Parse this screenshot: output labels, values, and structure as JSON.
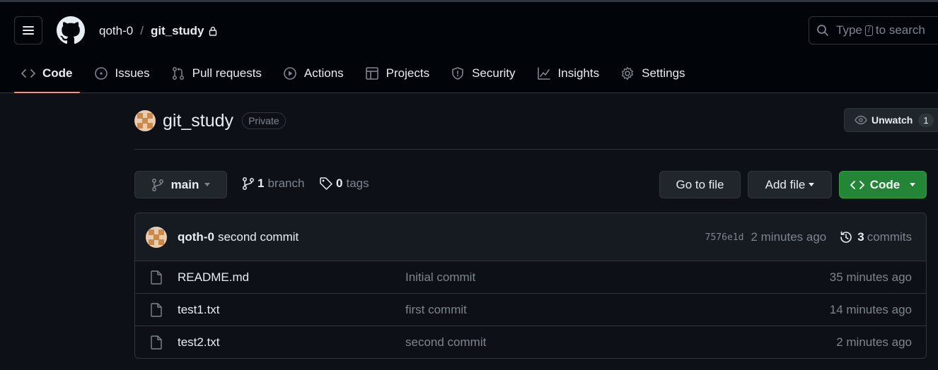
{
  "header": {
    "owner": "qoth-0",
    "separator": "/",
    "repo": "git_study",
    "search": {
      "prefix": "Type",
      "key": "/",
      "suffix": "to search"
    }
  },
  "tabs": [
    {
      "label": "Code",
      "icon": "code-icon",
      "active": true
    },
    {
      "label": "Issues",
      "icon": "issue-opened-icon"
    },
    {
      "label": "Pull requests",
      "icon": "git-pull-request-icon"
    },
    {
      "label": "Actions",
      "icon": "play-icon"
    },
    {
      "label": "Projects",
      "icon": "table-icon"
    },
    {
      "label": "Security",
      "icon": "shield-icon"
    },
    {
      "label": "Insights",
      "icon": "graph-icon"
    },
    {
      "label": "Settings",
      "icon": "gear-icon"
    }
  ],
  "repo_header": {
    "name": "git_study",
    "visibility": "Private",
    "unwatch_label": "Unwatch",
    "unwatch_count": "1"
  },
  "toolbar": {
    "branch": "main",
    "branch_count": "1",
    "branch_label": "branch",
    "tag_count": "0",
    "tag_label": "tags",
    "goto_file": "Go to file",
    "add_file": "Add file",
    "code": "Code"
  },
  "latest_commit": {
    "author": "qoth-0",
    "message": "second commit",
    "sha": "7576e1d",
    "age": "2 minutes ago",
    "commit_count": "3",
    "commit_label": "commits"
  },
  "files": [
    {
      "name": "README.md",
      "message": "Initial commit",
      "age": "35 minutes ago"
    },
    {
      "name": "test1.txt",
      "message": "first commit",
      "age": "14 minutes ago"
    },
    {
      "name": "test2.txt",
      "message": "second commit",
      "age": "2 minutes ago"
    }
  ],
  "colors": {
    "background": "#0d1117",
    "header": "#010409",
    "accent_underline": "#fd8c73",
    "code_button": "#238636",
    "muted_text": "#7d8590"
  }
}
